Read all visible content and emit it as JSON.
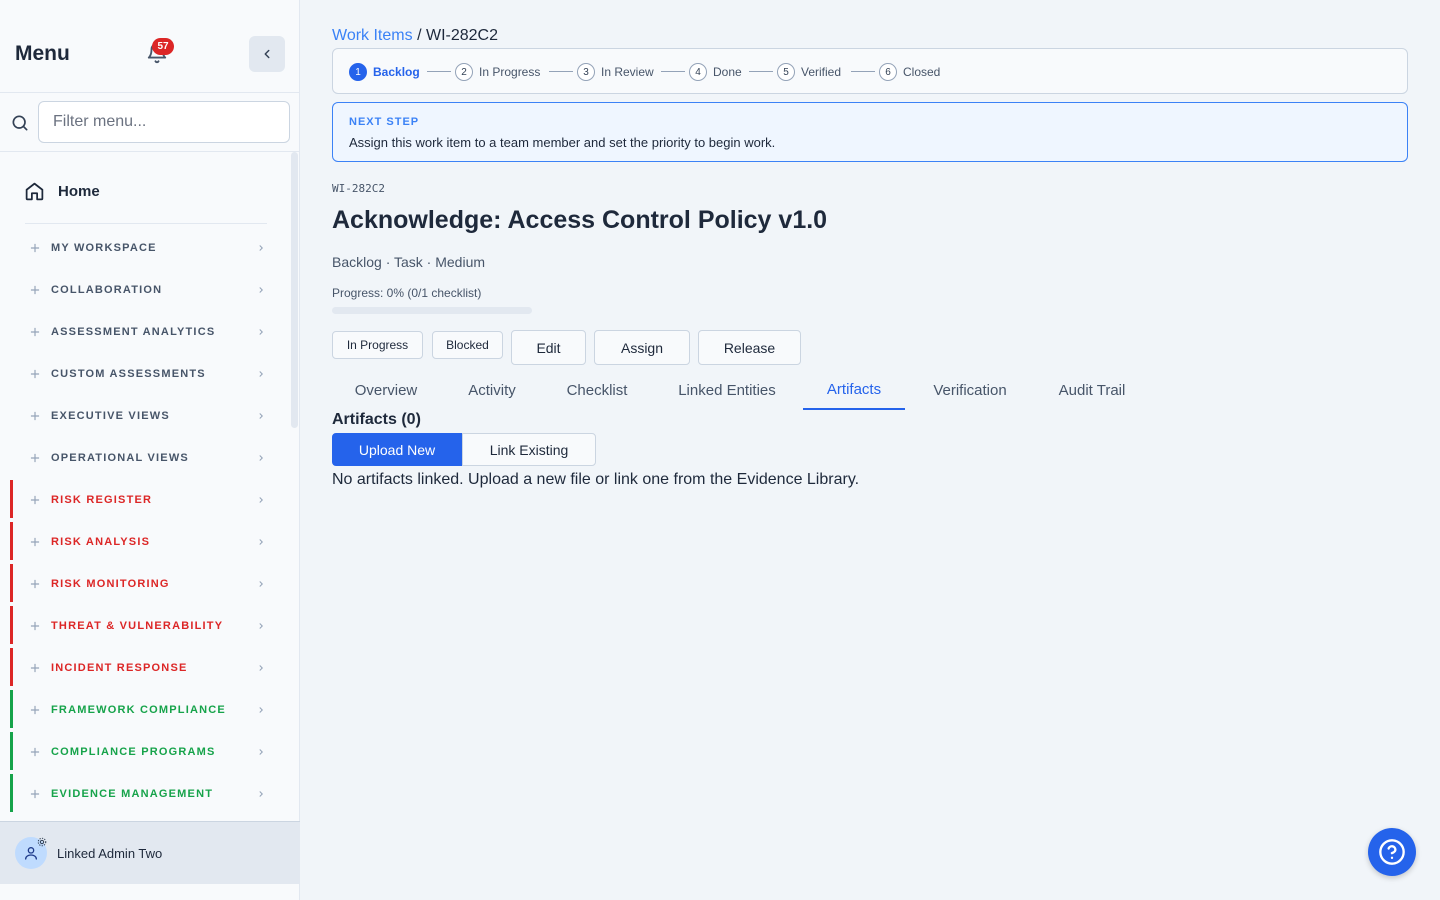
{
  "sidebar": {
    "title": "Menu",
    "notification_count": "57",
    "search_placeholder": "Filter menu...",
    "home_label": "Home",
    "groups": [
      {
        "label": "MY WORKSPACE",
        "color": "#475569",
        "accent": ""
      },
      {
        "label": "COLLABORATION",
        "color": "#475569",
        "accent": ""
      },
      {
        "label": "ASSESSMENT ANALYTICS",
        "color": "#475569",
        "accent": ""
      },
      {
        "label": "CUSTOM ASSESSMENTS",
        "color": "#475569",
        "accent": ""
      },
      {
        "label": "EXECUTIVE VIEWS",
        "color": "#475569",
        "accent": ""
      },
      {
        "label": "OPERATIONAL VIEWS",
        "color": "#475569",
        "accent": ""
      },
      {
        "label": "RISK REGISTER",
        "color": "#dc2626",
        "accent": "#dc2626"
      },
      {
        "label": "RISK ANALYSIS",
        "color": "#dc2626",
        "accent": "#dc2626"
      },
      {
        "label": "RISK MONITORING",
        "color": "#dc2626",
        "accent": "#dc2626"
      },
      {
        "label": "THREAT & VULNERABILITY",
        "color": "#dc2626",
        "accent": "#dc2626"
      },
      {
        "label": "INCIDENT RESPONSE",
        "color": "#dc2626",
        "accent": "#dc2626"
      },
      {
        "label": "FRAMEWORK COMPLIANCE",
        "color": "#16a34a",
        "accent": "#16a34a"
      },
      {
        "label": "COMPLIANCE PROGRAMS",
        "color": "#16a34a",
        "accent": "#16a34a"
      },
      {
        "label": "EVIDENCE MANAGEMENT",
        "color": "#16a34a",
        "accent": "#16a34a"
      }
    ],
    "user_name": "Linked Admin Two"
  },
  "breadcrumb": {
    "parent": "Work Items",
    "separator": "/",
    "current": "WI-282C2"
  },
  "stepper": {
    "steps": [
      {
        "num": "1",
        "label": "Backlog",
        "active": true
      },
      {
        "num": "2",
        "label": "In Progress",
        "active": false
      },
      {
        "num": "3",
        "label": "In Review",
        "active": false
      },
      {
        "num": "4",
        "label": "Done",
        "active": false
      },
      {
        "num": "5",
        "label": "Verified",
        "active": false
      },
      {
        "num": "6",
        "label": "Closed",
        "active": false
      }
    ]
  },
  "next_step": {
    "kicker": "NEXT STEP",
    "text": "Assign this work item to a team member and set the priority to begin work."
  },
  "work_item": {
    "id": "WI-282C2",
    "title": "Acknowledge: Access Control Policy v1.0",
    "meta": "Backlog · Task · Medium",
    "progress_text": "Progress: 0% (0/1 checklist)",
    "progress_fraction": 0
  },
  "actions": {
    "in_progress": "In Progress",
    "blocked": "Blocked",
    "edit": "Edit",
    "assign": "Assign",
    "release": "Release"
  },
  "tabs": [
    {
      "label": "Overview",
      "active": false
    },
    {
      "label": "Activity",
      "active": false
    },
    {
      "label": "Checklist",
      "active": false
    },
    {
      "label": "Linked Entities",
      "active": false
    },
    {
      "label": "Artifacts",
      "active": true
    },
    {
      "label": "Verification",
      "active": false
    },
    {
      "label": "Audit Trail",
      "active": false
    }
  ],
  "artifacts": {
    "title": "Artifacts (0)",
    "upload_label": "Upload New",
    "link_label": "Link Existing",
    "empty_text": "No artifacts linked. Upload a new file or link one from the Evidence Library."
  },
  "colors": {
    "accent": "#2563eb",
    "danger": "#dc2626",
    "success": "#16a34a"
  }
}
